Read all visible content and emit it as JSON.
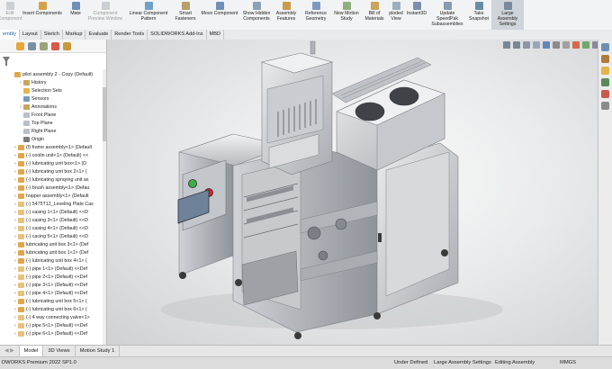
{
  "ribbon": [
    {
      "label": "Edit Component",
      "disabled": true,
      "icon": "edit-component-icon"
    },
    {
      "label": "Insert Components",
      "disabled": false,
      "icon": "insert-components-icon"
    },
    {
      "label": "Mate",
      "disabled": false,
      "icon": "mate-icon"
    },
    {
      "label": "Component Preview Window",
      "disabled": true,
      "icon": "preview-window-icon"
    },
    {
      "label": "Linear Component Pattern",
      "disabled": false,
      "icon": "linear-pattern-icon"
    },
    {
      "label": "Smart Fasteners",
      "disabled": false,
      "icon": "smart-fasteners-icon"
    },
    {
      "label": "Move Component",
      "disabled": false,
      "icon": "move-component-icon"
    },
    {
      "label": "Show Hidden Components",
      "disabled": false,
      "icon": "show-hidden-icon"
    },
    {
      "label": "Assembly Features",
      "disabled": false,
      "icon": "assembly-features-icon"
    },
    {
      "label": "Reference Geometry",
      "disabled": false,
      "icon": "reference-geometry-icon"
    },
    {
      "label": "New Motion Study",
      "disabled": false,
      "icon": "motion-study-icon"
    },
    {
      "label": "Bill of Materials",
      "disabled": false,
      "icon": "bill-of-materials-icon"
    },
    {
      "label": "ploded View",
      "disabled": false,
      "icon": "exploded-view-icon"
    },
    {
      "label": "Instant3D",
      "disabled": false,
      "icon": "instant3d-icon"
    },
    {
      "label": "Update SpeedPak Subassemblies",
      "disabled": false,
      "icon": "speedpak-icon"
    },
    {
      "label": "Take Snapshot",
      "disabled": false,
      "icon": "snapshot-icon"
    },
    {
      "label": "Large Assembly Settings",
      "disabled": false,
      "icon": "large-assembly-icon"
    }
  ],
  "tabs": [
    "embly",
    "Layout",
    "Sketch",
    "Markup",
    "Evaluate",
    "Render Tools",
    "SOLIDWORKS Add-Ins",
    "MBD"
  ],
  "active_tab": "embly",
  "tree": {
    "root": "pilot assembly 2 - Copy  (Default)",
    "items": [
      {
        "arrow": "›",
        "label": "History",
        "kind": "history"
      },
      {
        "arrow": "",
        "label": "Selection Sets",
        "kind": "folder"
      },
      {
        "arrow": "",
        "label": "Sensors",
        "kind": "sensor"
      },
      {
        "arrow": "›",
        "label": "Annotations",
        "kind": "annotation"
      },
      {
        "arrow": "",
        "label": "Front Plane",
        "kind": "plane"
      },
      {
        "arrow": "",
        "label": "Top Plane",
        "kind": "plane"
      },
      {
        "arrow": "",
        "label": "Right Plane",
        "kind": "plane"
      },
      {
        "arrow": "",
        "label": "Origin",
        "kind": "origin"
      },
      {
        "arrow": "›",
        "label": "(f) frame assembly<1> (Default",
        "kind": "asm"
      },
      {
        "arrow": "›",
        "label": "(-) coolin unit<1> (Default) <<",
        "kind": "asm"
      },
      {
        "arrow": "›",
        "label": "(-) lubricating unit box<1> (D",
        "kind": "asm"
      },
      {
        "arrow": "›",
        "label": "(-) lubricating unit box 2<1> (",
        "kind": "asm"
      },
      {
        "arrow": "›",
        "label": "(-) lubricating spraying unit as",
        "kind": "asm"
      },
      {
        "arrow": "›",
        "label": "(-) brush assembly<1> (Defau",
        "kind": "asm"
      },
      {
        "arrow": "›",
        "label": "hopper assembly<1> (Default",
        "kind": "asm"
      },
      {
        "arrow": "›",
        "label": "(-) 5475T12_Leveling Plate Cas",
        "kind": "part"
      },
      {
        "arrow": "›",
        "label": "(-) casing 1<1> (Default) <<D",
        "kind": "part"
      },
      {
        "arrow": "›",
        "label": "(-) casing 3<1> (Default) <<D",
        "kind": "part"
      },
      {
        "arrow": "›",
        "label": "(-) casing 4<1> (Default) <<D",
        "kind": "part"
      },
      {
        "arrow": "›",
        "label": "(-) cacing 5<1> (Default) <<D",
        "kind": "part"
      },
      {
        "arrow": "›",
        "label": "lubricating unit box 3<1> (Def",
        "kind": "asm"
      },
      {
        "arrow": "›",
        "label": "lubricating unit box 1<1> (Def",
        "kind": "asm"
      },
      {
        "arrow": "›",
        "label": "(-) lubricating unit box 4<1> (",
        "kind": "asm"
      },
      {
        "arrow": "›",
        "label": "(-) pipe 1<1> (Default) <<Def",
        "kind": "part"
      },
      {
        "arrow": "›",
        "label": "(-) pipe 2<1> (Default) <<Def",
        "kind": "part"
      },
      {
        "arrow": "›",
        "label": "(-) pipe 3<1> (Default) <<Def",
        "kind": "part"
      },
      {
        "arrow": "›",
        "label": "(-) pipe 4<1> (Default) <<Def",
        "kind": "part"
      },
      {
        "arrow": "›",
        "label": "(-) lubricating unit box 5<1> (",
        "kind": "asm"
      },
      {
        "arrow": "›",
        "label": "(-) lubricating unit box 6<1> (",
        "kind": "asm"
      },
      {
        "arrow": "›",
        "label": "(-) 4 way connecting valve<1>",
        "kind": "part"
      },
      {
        "arrow": "›",
        "label": "(-) pipe 5<1> (Default) <<Def",
        "kind": "part"
      },
      {
        "arrow": "›",
        "label": "(-) pipe 6<1> (Default) <<Def",
        "kind": "part"
      }
    ]
  },
  "bottom_tabs": [
    "Model",
    "3D Views",
    "Motion Study 1"
  ],
  "active_bottom_tab": "Model",
  "status": {
    "product": "DWORKS Premium 2022 SP1.0",
    "definition": "Under Defined",
    "large_asm": "Large Assembly Settings",
    "mode": "Editing Assembly",
    "units": "MMGS"
  },
  "colors": {
    "accent": "#1b5fa8",
    "steel": "#b9bcc0",
    "button_green": "#3cb043",
    "button_red": "#e02020",
    "screen": "#6e8399"
  }
}
